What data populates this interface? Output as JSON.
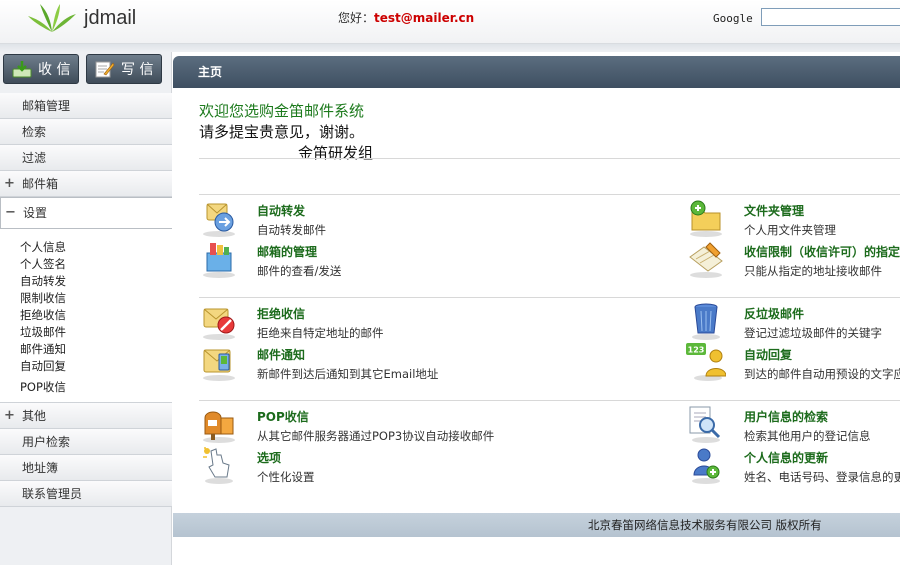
{
  "header": {
    "logo_text": "jdmail",
    "greeting_label": "您好：",
    "user_email": "test@mailer.cn",
    "google_label": "Google",
    "google_value": ""
  },
  "sidebar": {
    "inbox_label": "收 信",
    "write_label": "写 信",
    "items": {
      "mailbox_manage": "邮箱管理",
      "search": "检索",
      "filter": "过滤",
      "mailbox": "邮件箱",
      "settings": "设置",
      "other": "其他",
      "user_search": "用户检索",
      "address_book": "地址簿",
      "contact_admin": "联系管理员"
    },
    "plus_sign": "+",
    "minus_sign": "−",
    "settings_sub": [
      "个人信息",
      "个人签名",
      "自动转发",
      "限制收信",
      "拒绝收信",
      "垃圾邮件",
      "邮件通知",
      "自动回复",
      "POP收信"
    ]
  },
  "main": {
    "title": "主页",
    "welcome_line1": "欢迎您选购金笛邮件系统",
    "welcome_line2": "请多提宝贵意见，谢谢。",
    "welcome_line3": "金笛研发组",
    "features": {
      "auto_forward": {
        "title": "自动转发",
        "desc": "自动转发邮件"
      },
      "folder_manage": {
        "title": "文件夹管理",
        "desc": "个人用文件夹管理"
      },
      "mailbox_manage": {
        "title": "邮箱的管理",
        "desc": "邮件的查看/发送"
      },
      "receive_limit": {
        "title": "收信限制（收信许可）的指定",
        "desc": "只能从指定的地址接收邮件"
      },
      "reject_receive": {
        "title": "拒绝收信",
        "desc": "拒绝来自特定地址的邮件"
      },
      "anti_spam": {
        "title": "反垃圾邮件",
        "desc": "登记过滤垃圾邮件的关键字"
      },
      "mail_notify": {
        "title": "邮件通知",
        "desc": "新邮件到达后通知到其它Email地址"
      },
      "auto_reply": {
        "title": "自动回复",
        "desc": "到达的邮件自动用预设的文字应"
      },
      "pop_receive": {
        "title": "POP收信",
        "desc": "从其它邮件服务器通过POP3协议自动接收邮件"
      },
      "user_info_search": {
        "title": "用户信息的检索",
        "desc": "检索其他用户的登记信息"
      },
      "options": {
        "title": "选项",
        "desc": "个性化设置"
      },
      "personal_update": {
        "title": "个人信息的更新",
        "desc": "姓名、电话号码、登录信息的更"
      }
    },
    "auto_reply_badge": "123"
  },
  "footer": {
    "copyright": "北京春笛网络信息技术服务有限公司 版权所有"
  }
}
